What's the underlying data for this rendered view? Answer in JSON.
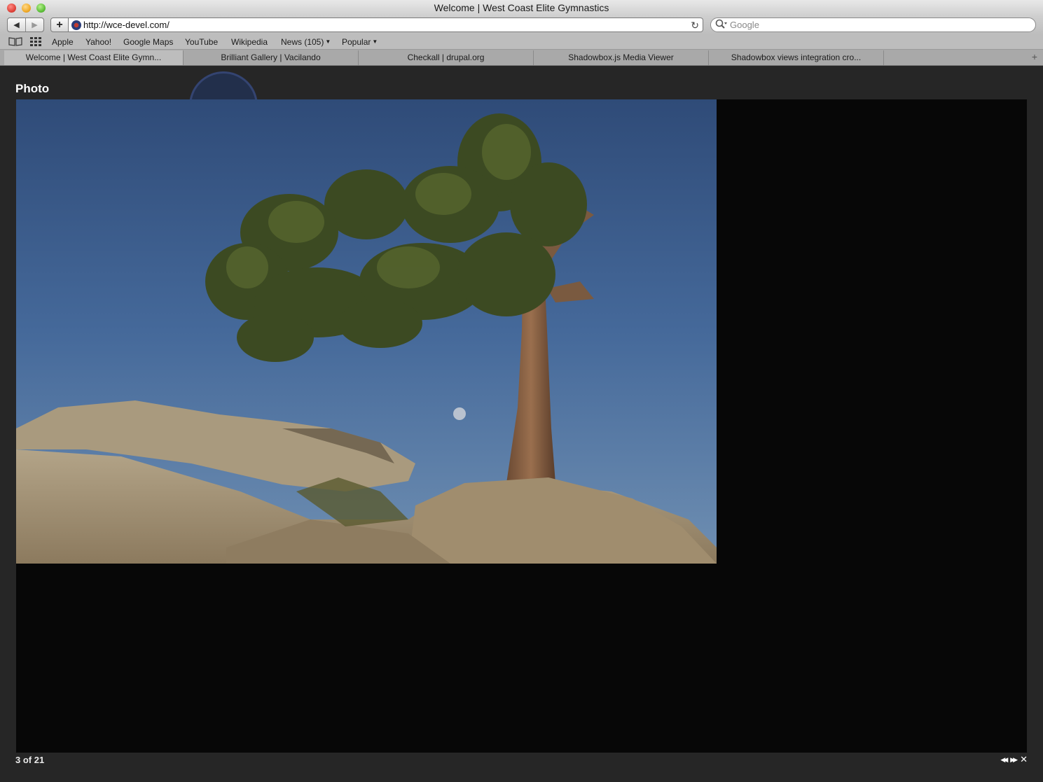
{
  "window": {
    "title": "Welcome | West Coast Elite Gymnastics"
  },
  "toolbar": {
    "back_icon": "◀",
    "forward_icon": "▶",
    "add_icon": "+",
    "url": "http://wce-devel.com/",
    "reload_icon": "↻",
    "search_placeholder": "Google",
    "search_icon": "🔍"
  },
  "bookmarks": {
    "items": [
      {
        "label": "Apple"
      },
      {
        "label": "Yahoo!"
      },
      {
        "label": "Google Maps"
      },
      {
        "label": "YouTube"
      },
      {
        "label": "Wikipedia"
      },
      {
        "label": "News (105)"
      },
      {
        "label": "Popular"
      }
    ]
  },
  "tabs": [
    {
      "label": "Welcome | West Coast Elite Gymn...",
      "active": true
    },
    {
      "label": "Brilliant Gallery | Vacilando",
      "active": false
    },
    {
      "label": "Checkall | drupal.org",
      "active": false
    },
    {
      "label": "Shadowbox.js Media Viewer",
      "active": false
    },
    {
      "label": "Shadowbox views integration cro...",
      "active": false
    }
  ],
  "shadowbox": {
    "title": "Photo",
    "counter": "3 of 21",
    "prev_icon": "◀◀",
    "next_icon": "▶▶",
    "close_icon": "✕"
  },
  "colors": {
    "overlay": "#262626",
    "viewer_bg": "#070707",
    "sky_top": "#2e4a76",
    "sky_bottom": "#6f8fb3"
  }
}
